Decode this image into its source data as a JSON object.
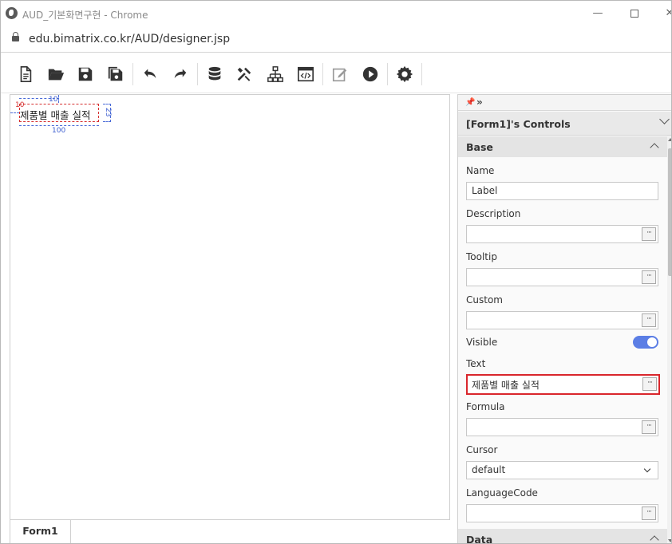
{
  "window": {
    "title": "AUD_기본화면구현 - Chrome",
    "controls": {
      "minimize": "—",
      "close": "✕"
    }
  },
  "address": {
    "url": "edu.bimatrix.co.kr/AUD/designer.jsp"
  },
  "toolbar": {
    "buttons": [
      {
        "name": "new-document-icon"
      },
      {
        "name": "open-folder-icon"
      },
      {
        "name": "save-icon"
      },
      {
        "name": "save-all-icon"
      },
      {
        "name": "undo-icon"
      },
      {
        "name": "redo-icon"
      },
      {
        "name": "database-icon"
      },
      {
        "name": "tools-icon"
      },
      {
        "name": "hierarchy-icon"
      },
      {
        "name": "code-window-icon"
      },
      {
        "name": "edit-icon"
      },
      {
        "name": "play-icon"
      },
      {
        "name": "settings-icon"
      }
    ]
  },
  "canvas": {
    "label_text": "제품별 매출 실적",
    "dims": {
      "top": "10",
      "left": "10",
      "height": "23",
      "width": "100"
    }
  },
  "form_tab": {
    "label": "Form1"
  },
  "panel": {
    "controls_title": "[Form1]'s Controls",
    "groups": {
      "base": "Base",
      "data": "Data"
    },
    "props": {
      "name": {
        "label": "Name",
        "value": "Label"
      },
      "description": {
        "label": "Description",
        "value": ""
      },
      "tooltip": {
        "label": "Tooltip",
        "value": ""
      },
      "custom": {
        "label": "Custom",
        "value": ""
      },
      "visible": {
        "label": "Visible",
        "value": true
      },
      "text": {
        "label": "Text",
        "value": "제품별 매출 실적"
      },
      "formula": {
        "label": "Formula",
        "value": ""
      },
      "cursor": {
        "label": "Cursor",
        "value": "default"
      },
      "languagecode": {
        "label": "LanguageCode",
        "value": ""
      }
    },
    "more_label": "···"
  },
  "colors": {
    "accent": "#5b7ee5",
    "highlight": "#d9262c",
    "guide": "#4a6bd8"
  }
}
